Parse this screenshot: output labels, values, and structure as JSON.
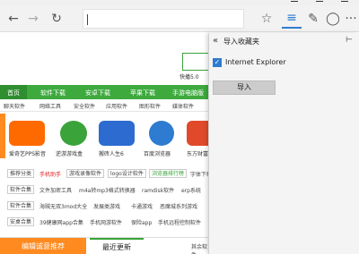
{
  "page": {
    "quick_label": "快播5.0",
    "nav": [
      "首页",
      "软件下载",
      "安卓下载",
      "苹果下载",
      "手游电脑版"
    ],
    "subnav": [
      "聊天软件",
      "网络工具",
      "安全软件",
      "应用软件",
      "图形软件",
      "媒体软件"
    ],
    "apps": [
      {
        "label": "爱奇艺PPS影音",
        "color": "#ff6a00"
      },
      {
        "label": "逆游游戏盒",
        "color": "#3aa33a"
      },
      {
        "label": "搬砖人生6",
        "color": "#2d6bd1"
      },
      {
        "label": "百度浏览器",
        "color": "#2d7cd1"
      },
      {
        "label": "东方财富",
        "color": "#e04a2a"
      }
    ],
    "rows": [
      {
        "tag": "推荐分类",
        "items": [
          "手机助手",
          "游戏录像软件",
          "logo设计软件",
          "浏览器排行榜",
          "字体下载"
        ]
      },
      {
        "tag": "软件合集",
        "items": [
          "文件加密工具",
          "m4a转mp3格式转换器",
          "ramdisk软件",
          "erp系统"
        ]
      },
      {
        "tag": "软件合集",
        "items": [
          "海贼无双3mod大全",
          "发展类游戏",
          "卡通游戏",
          "恶魔城系列游戏"
        ]
      },
      {
        "tag": "安桌合集",
        "items": [
          "39健康网app合集",
          "手机网游软件",
          "保险app",
          "手机远程控制软件"
        ]
      }
    ],
    "rec_label": "编辑诚意推荐",
    "latest_label": "最近更新",
    "others_label": "其余软件"
  },
  "pane": {
    "title": "导入收藏夹",
    "checkbox_label": "Internet Explorer",
    "checked": true,
    "import_label": "导入"
  },
  "icons": [
    "back-icon",
    "forward-icon",
    "refresh-icon",
    "star-icon",
    "hub-icon",
    "notes-icon",
    "share-icon",
    "more-icon"
  ]
}
